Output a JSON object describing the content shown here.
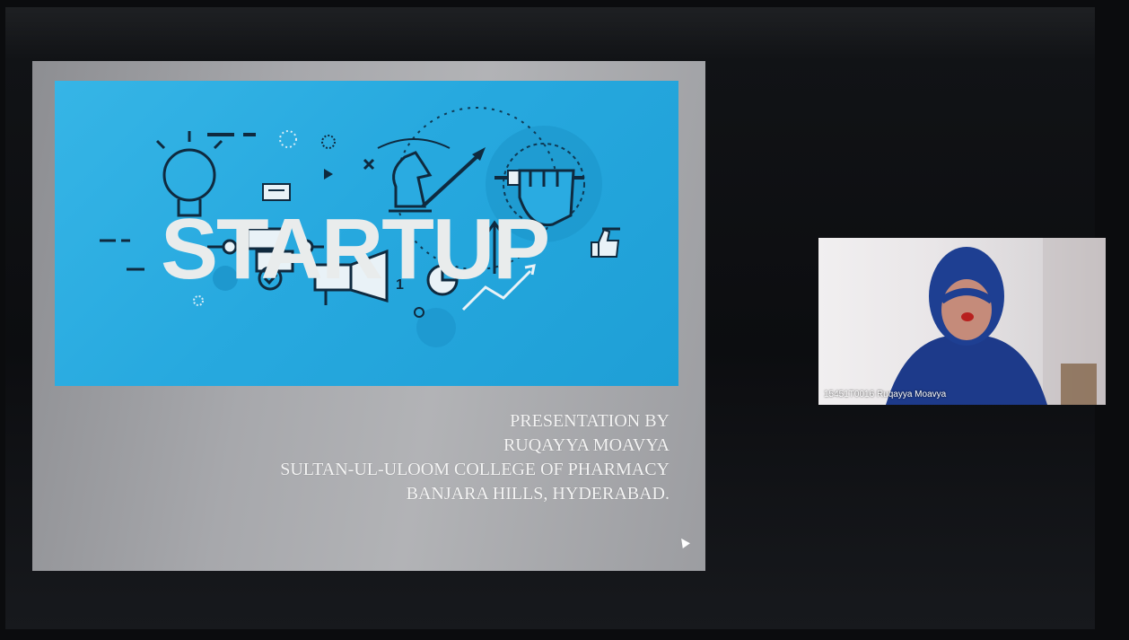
{
  "slide": {
    "graphic_word": "STARTUP",
    "presenter_lines": [
      "PRESENTATION BY",
      "RUQAYYA MOAVYA",
      "SULTAN-UL-ULOOM COLLEGE OF PHARMACY",
      "BANJARA HILLS, HYDERABAD."
    ],
    "banner_color": "#2aabe1",
    "text_color": "#f4f4f4"
  },
  "participant": {
    "label": "15451T0016 Ruqayya Moavya"
  },
  "icons": [
    "lightbulb-icon",
    "chess-knight-icon",
    "fist-icon",
    "megaphone-icon",
    "gear-icon",
    "thumbs-up-icon",
    "flowchart-icon",
    "pie-chart-icon",
    "growth-arrow-icon"
  ]
}
